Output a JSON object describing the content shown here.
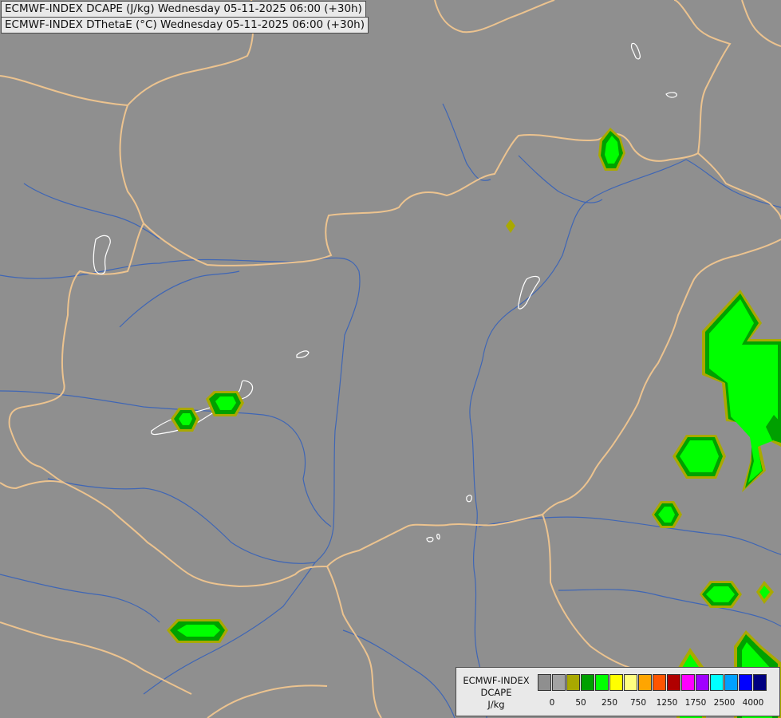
{
  "titles": {
    "line1": "ECMWF-INDEX DCAPE (J/kg) Wednesday 05-11-2025 06:00 (+30h)",
    "line2": "ECMWF-INDEX DThetaE (°C) Wednesday 05-11-2025 06:00 (+30h)"
  },
  "legend": {
    "label_line1": "ECMWF-INDEX",
    "label_line2": "DCAPE",
    "label_line3": "J/kg",
    "swatch_colors": [
      "#8f8f8f",
      "#a3a3a3",
      "#a9a900",
      "#00a000",
      "#00ff00",
      "#ffff00",
      "#ffff80",
      "#ffa500",
      "#ff5500",
      "#b00000",
      "#ff00ff",
      "#a000ff",
      "#00ffff",
      "#00a0ff",
      "#0000ff",
      "#000080"
    ],
    "tick_labels": [
      {
        "text": "0",
        "index": 1
      },
      {
        "text": "50",
        "index": 3
      },
      {
        "text": "250",
        "index": 5
      },
      {
        "text": "750",
        "index": 7
      },
      {
        "text": "1250",
        "index": 9
      },
      {
        "text": "1750",
        "index": 11
      },
      {
        "text": "2500",
        "index": 13
      },
      {
        "text": "4000",
        "index": 15
      }
    ]
  },
  "map": {
    "background_color": "#8f8f8f",
    "border_color": "#ecc38f",
    "river_color": "#3f66b5",
    "lake_color": "#ffffff",
    "fill_colors": {
      "outer": "#a9a900",
      "mid": "#00a000",
      "inner": "#00ff00"
    }
  }
}
